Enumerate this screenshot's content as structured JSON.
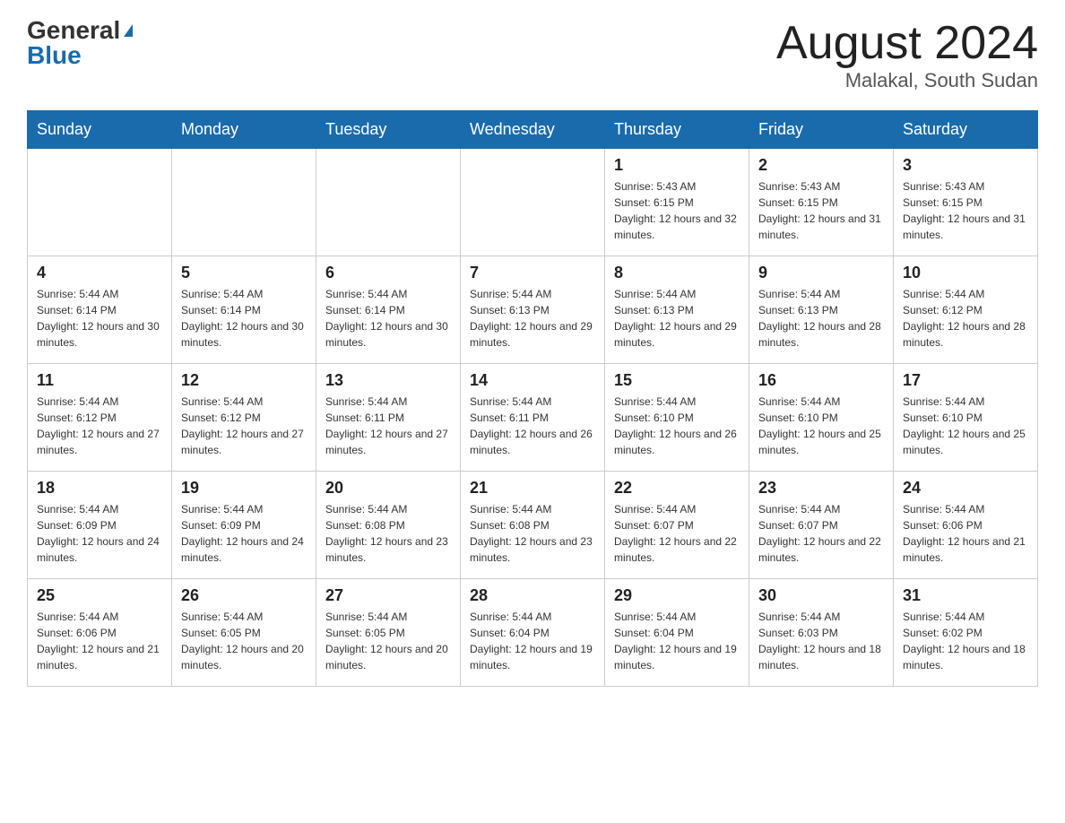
{
  "header": {
    "logo_general": "General",
    "logo_blue": "Blue",
    "calendar_title": "August 2024",
    "calendar_subtitle": "Malakal, South Sudan"
  },
  "weekdays": [
    "Sunday",
    "Monday",
    "Tuesday",
    "Wednesday",
    "Thursday",
    "Friday",
    "Saturday"
  ],
  "weeks": [
    [
      {
        "day": "",
        "info": ""
      },
      {
        "day": "",
        "info": ""
      },
      {
        "day": "",
        "info": ""
      },
      {
        "day": "",
        "info": ""
      },
      {
        "day": "1",
        "info": "Sunrise: 5:43 AM\nSunset: 6:15 PM\nDaylight: 12 hours and 32 minutes."
      },
      {
        "day": "2",
        "info": "Sunrise: 5:43 AM\nSunset: 6:15 PM\nDaylight: 12 hours and 31 minutes."
      },
      {
        "day": "3",
        "info": "Sunrise: 5:43 AM\nSunset: 6:15 PM\nDaylight: 12 hours and 31 minutes."
      }
    ],
    [
      {
        "day": "4",
        "info": "Sunrise: 5:44 AM\nSunset: 6:14 PM\nDaylight: 12 hours and 30 minutes."
      },
      {
        "day": "5",
        "info": "Sunrise: 5:44 AM\nSunset: 6:14 PM\nDaylight: 12 hours and 30 minutes."
      },
      {
        "day": "6",
        "info": "Sunrise: 5:44 AM\nSunset: 6:14 PM\nDaylight: 12 hours and 30 minutes."
      },
      {
        "day": "7",
        "info": "Sunrise: 5:44 AM\nSunset: 6:13 PM\nDaylight: 12 hours and 29 minutes."
      },
      {
        "day": "8",
        "info": "Sunrise: 5:44 AM\nSunset: 6:13 PM\nDaylight: 12 hours and 29 minutes."
      },
      {
        "day": "9",
        "info": "Sunrise: 5:44 AM\nSunset: 6:13 PM\nDaylight: 12 hours and 28 minutes."
      },
      {
        "day": "10",
        "info": "Sunrise: 5:44 AM\nSunset: 6:12 PM\nDaylight: 12 hours and 28 minutes."
      }
    ],
    [
      {
        "day": "11",
        "info": "Sunrise: 5:44 AM\nSunset: 6:12 PM\nDaylight: 12 hours and 27 minutes."
      },
      {
        "day": "12",
        "info": "Sunrise: 5:44 AM\nSunset: 6:12 PM\nDaylight: 12 hours and 27 minutes."
      },
      {
        "day": "13",
        "info": "Sunrise: 5:44 AM\nSunset: 6:11 PM\nDaylight: 12 hours and 27 minutes."
      },
      {
        "day": "14",
        "info": "Sunrise: 5:44 AM\nSunset: 6:11 PM\nDaylight: 12 hours and 26 minutes."
      },
      {
        "day": "15",
        "info": "Sunrise: 5:44 AM\nSunset: 6:10 PM\nDaylight: 12 hours and 26 minutes."
      },
      {
        "day": "16",
        "info": "Sunrise: 5:44 AM\nSunset: 6:10 PM\nDaylight: 12 hours and 25 minutes."
      },
      {
        "day": "17",
        "info": "Sunrise: 5:44 AM\nSunset: 6:10 PM\nDaylight: 12 hours and 25 minutes."
      }
    ],
    [
      {
        "day": "18",
        "info": "Sunrise: 5:44 AM\nSunset: 6:09 PM\nDaylight: 12 hours and 24 minutes."
      },
      {
        "day": "19",
        "info": "Sunrise: 5:44 AM\nSunset: 6:09 PM\nDaylight: 12 hours and 24 minutes."
      },
      {
        "day": "20",
        "info": "Sunrise: 5:44 AM\nSunset: 6:08 PM\nDaylight: 12 hours and 23 minutes."
      },
      {
        "day": "21",
        "info": "Sunrise: 5:44 AM\nSunset: 6:08 PM\nDaylight: 12 hours and 23 minutes."
      },
      {
        "day": "22",
        "info": "Sunrise: 5:44 AM\nSunset: 6:07 PM\nDaylight: 12 hours and 22 minutes."
      },
      {
        "day": "23",
        "info": "Sunrise: 5:44 AM\nSunset: 6:07 PM\nDaylight: 12 hours and 22 minutes."
      },
      {
        "day": "24",
        "info": "Sunrise: 5:44 AM\nSunset: 6:06 PM\nDaylight: 12 hours and 21 minutes."
      }
    ],
    [
      {
        "day": "25",
        "info": "Sunrise: 5:44 AM\nSunset: 6:06 PM\nDaylight: 12 hours and 21 minutes."
      },
      {
        "day": "26",
        "info": "Sunrise: 5:44 AM\nSunset: 6:05 PM\nDaylight: 12 hours and 20 minutes."
      },
      {
        "day": "27",
        "info": "Sunrise: 5:44 AM\nSunset: 6:05 PM\nDaylight: 12 hours and 20 minutes."
      },
      {
        "day": "28",
        "info": "Sunrise: 5:44 AM\nSunset: 6:04 PM\nDaylight: 12 hours and 19 minutes."
      },
      {
        "day": "29",
        "info": "Sunrise: 5:44 AM\nSunset: 6:04 PM\nDaylight: 12 hours and 19 minutes."
      },
      {
        "day": "30",
        "info": "Sunrise: 5:44 AM\nSunset: 6:03 PM\nDaylight: 12 hours and 18 minutes."
      },
      {
        "day": "31",
        "info": "Sunrise: 5:44 AM\nSunset: 6:02 PM\nDaylight: 12 hours and 18 minutes."
      }
    ]
  ]
}
